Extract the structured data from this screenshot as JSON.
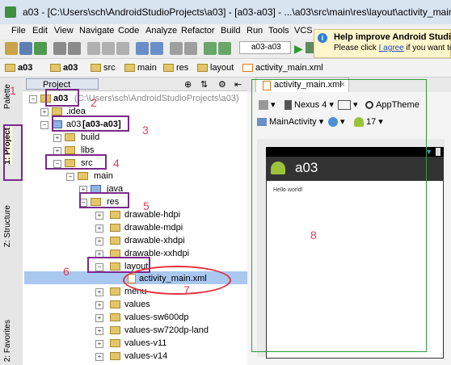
{
  "window": {
    "title": "a03 - [C:\\Users\\sch\\AndroidStudioProjects\\a03] - [a03-a03] - ...\\a03\\src\\main\\res\\layout\\activity_main.xml"
  },
  "menu": [
    "File",
    "Edit",
    "View",
    "Navigate",
    "Code",
    "Analyze",
    "Refactor",
    "Build",
    "Run",
    "Tools",
    "VCS"
  ],
  "toolbar": {
    "run_config": "a03-a03"
  },
  "notification": {
    "title": "Help improve Android Studio",
    "text_prefix": "Please click ",
    "link": "I agree",
    "text_suffix": " if you want to"
  },
  "breadcrumb": [
    "a03",
    "a03",
    "src",
    "main",
    "res",
    "layout",
    "activity_main.xml"
  ],
  "side_tabs": [
    "Palette",
    "1: Project",
    "Z: Structure",
    "2: Favorites"
  ],
  "project_panel": {
    "tab": "Project"
  },
  "tree": {
    "root_name": "a03",
    "root_path": "(C:\\Users\\sch\\AndroidStudioProjects\\a03)",
    "idea": ".idea",
    "module": "a03",
    "module_tag": "[a03-a03]",
    "build": "build",
    "libs": "libs",
    "src": "src",
    "main": "main",
    "java": "java",
    "res": "res",
    "drawable_hdpi": "drawable-hdpi",
    "drawable_mdpi": "drawable-mdpi",
    "drawable_xhdpi": "drawable-xhdpi",
    "drawable_xxhdpi": "drawable-xxhdpi",
    "layout": "layout",
    "activity_main": "activity_main.xml",
    "menu": "menu",
    "values": "values",
    "values_sw600dp": "values-sw600dp",
    "values_sw720dp_land": "values-sw720dp-land",
    "values_v11": "values-v11",
    "values_v14": "values-v14"
  },
  "editor": {
    "tab": "activity_main.xml",
    "device": "Nexus 4",
    "theme": "AppTheme",
    "activity": "MainActivity",
    "api": "17",
    "app_title": "a03",
    "hello": "Hello world!"
  },
  "annotations": [
    "1",
    "2",
    "3",
    "4",
    "5",
    "6",
    "7",
    "8"
  ],
  "colors": {
    "annotation_box": "#7a2a8a",
    "annotation_number": "#e04050",
    "preview_frame": "#2f9b3a",
    "selection": "#a8c8f0"
  }
}
